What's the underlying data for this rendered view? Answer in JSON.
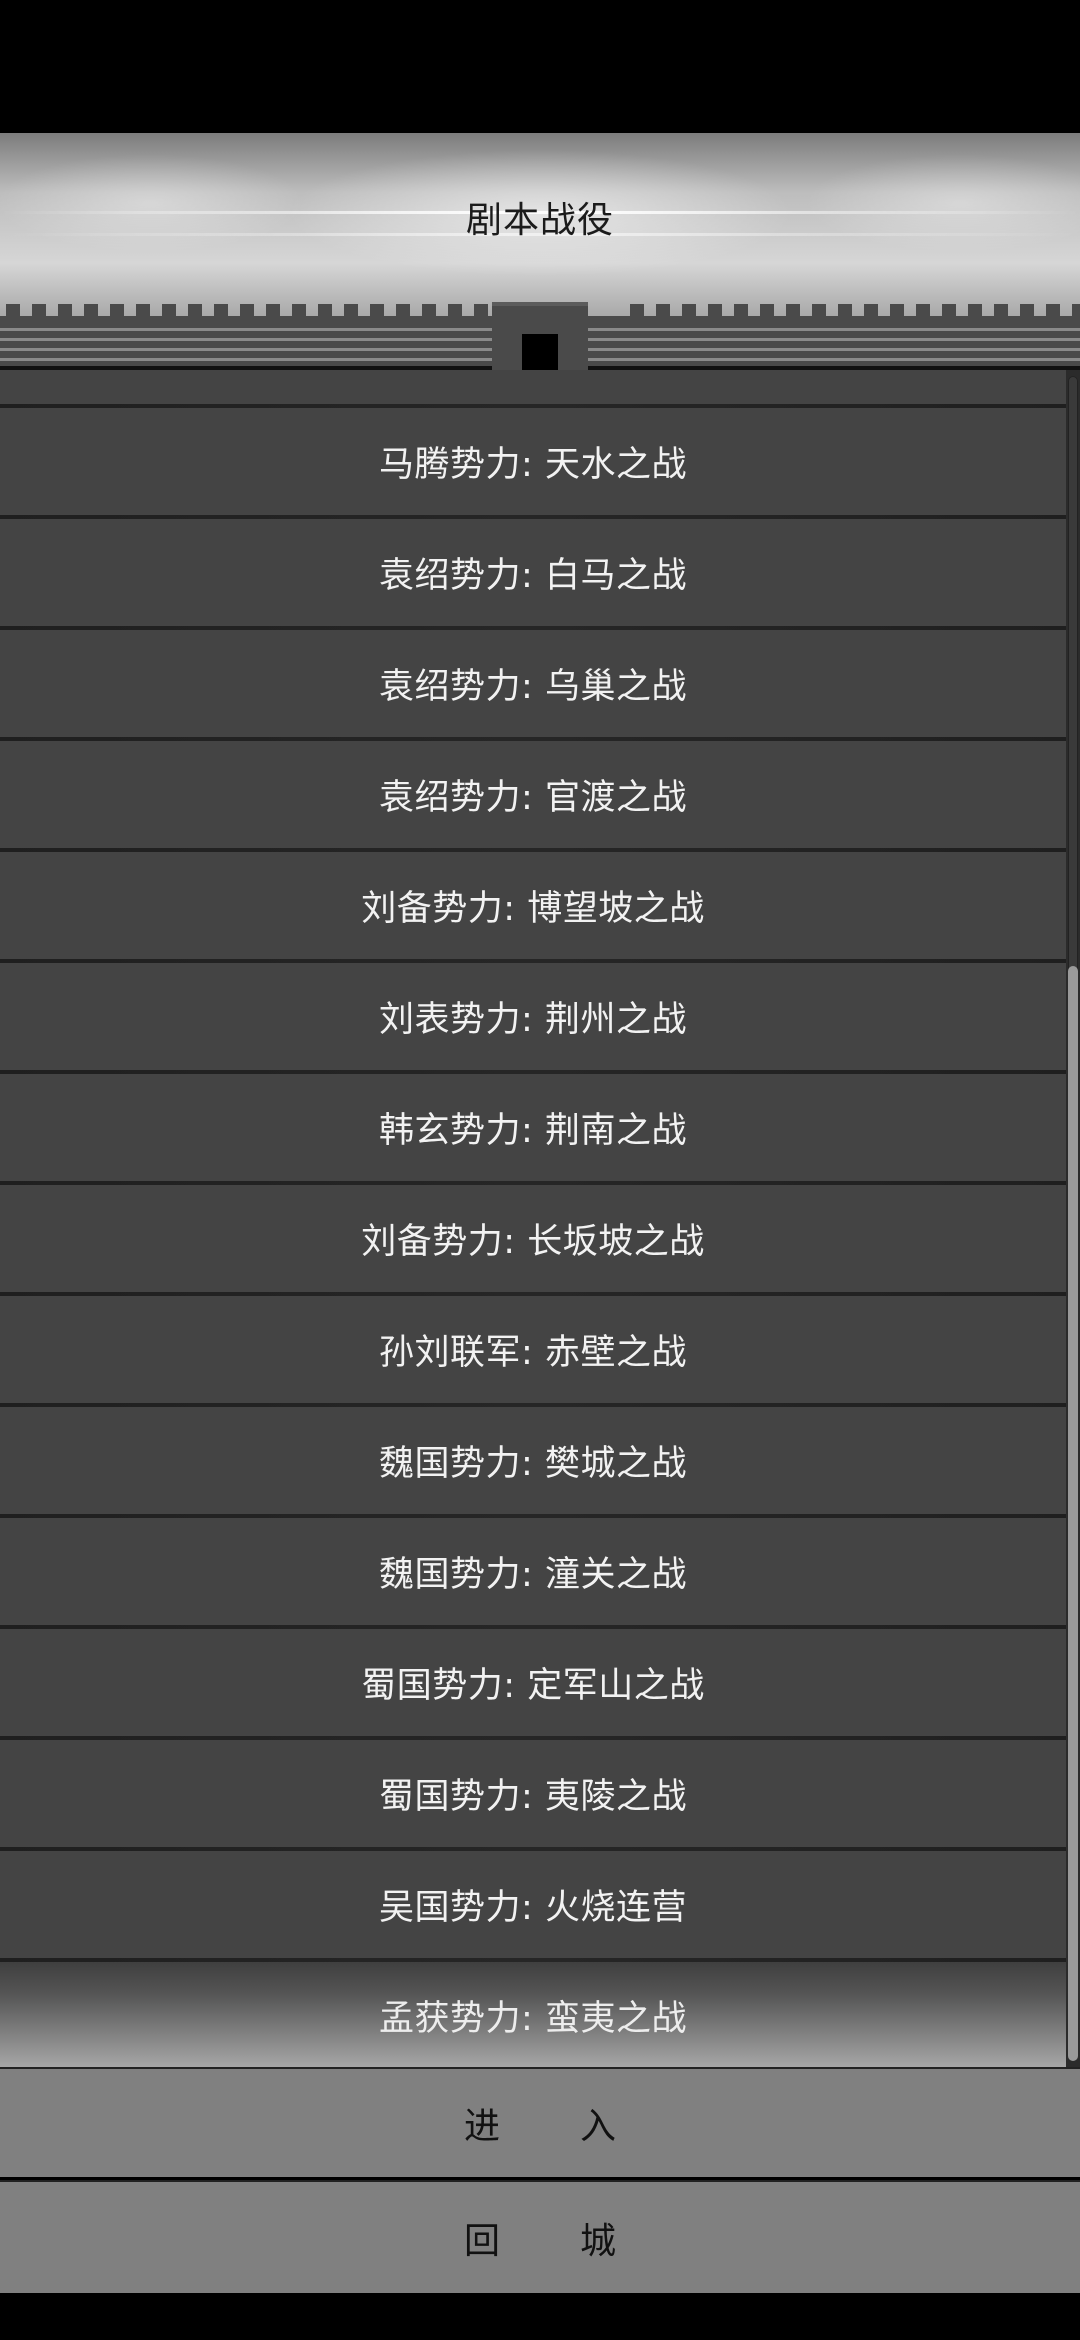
{
  "header": {
    "title": "剧本战役"
  },
  "campaigns": [
    "马腾势力: 天水之战",
    "袁绍势力: 白马之战",
    "袁绍势力: 乌巢之战",
    "袁绍势力: 官渡之战",
    "刘备势力: 博望坡之战",
    "刘表势力: 荆州之战",
    "韩玄势力: 荆南之战",
    "刘备势力: 长坂坡之战",
    "孙刘联军: 赤壁之战",
    "魏国势力: 樊城之战",
    "魏国势力: 潼关之战",
    "蜀国势力: 定军山之战",
    "蜀国势力: 夷陵之战",
    "吴国势力: 火烧连营",
    "孟获势力: 蛮夷之战"
  ],
  "scroll": {
    "thumb_start_fraction": 0.35,
    "thumb_end_fraction": 1.0
  },
  "buttons": {
    "enter": {
      "char1": "进",
      "char2": "入"
    },
    "back": {
      "char1": "回",
      "char2": "城"
    }
  },
  "colors": {
    "row_bg": "#444444",
    "separator": "#1f1f1f",
    "button_bg": "#808080",
    "text_light": "#f2f2f2"
  }
}
